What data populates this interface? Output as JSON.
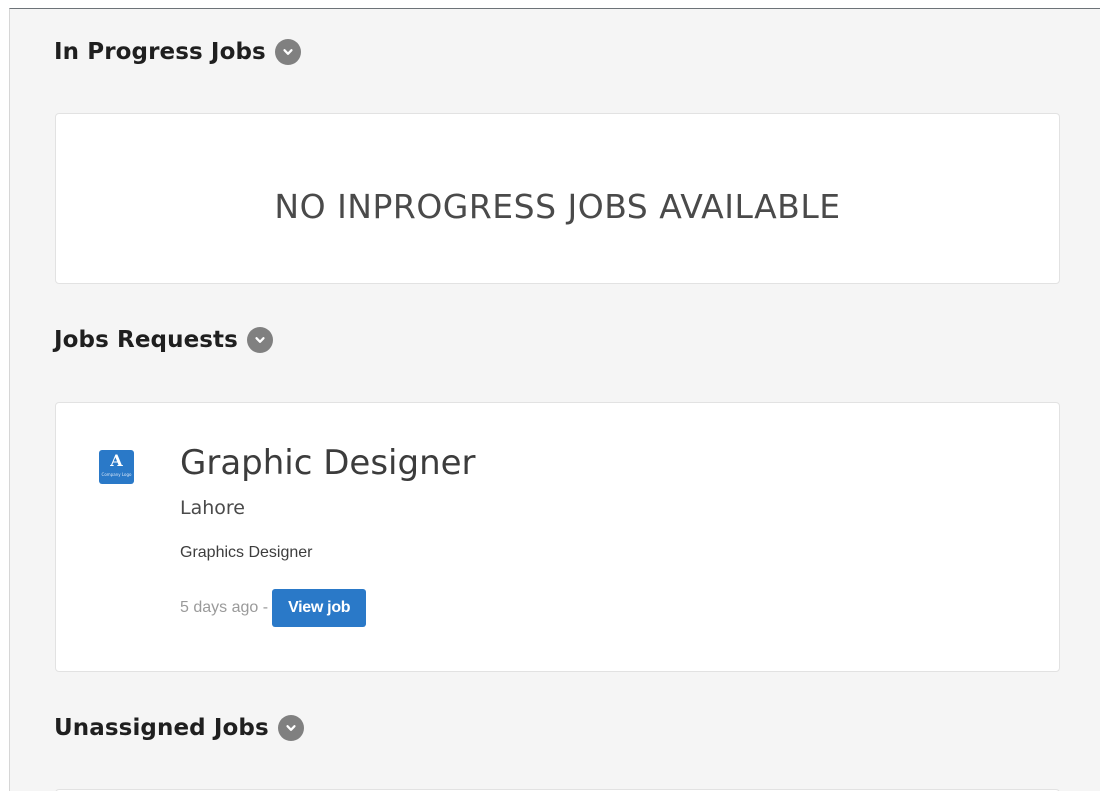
{
  "in_progress": {
    "heading": "In Progress Jobs",
    "toggle_icon": "chevron-down-icon",
    "empty_message": "NO INPROGRESS JOBS AVAILABLE"
  },
  "job_requests": {
    "heading": "Jobs Requests",
    "toggle_icon": "chevron-down-icon",
    "jobs": [
      {
        "logo_letter": "A",
        "logo_subtext": "Company Logo",
        "title": "Graphic Designer",
        "location": "Lahore",
        "category": "Graphics Designer",
        "posted": "5 days ago -",
        "action_label": "View job"
      }
    ]
  },
  "unassigned": {
    "heading": "Unassigned Jobs",
    "toggle_icon": "chevron-down-icon"
  },
  "colors": {
    "accent": "#2a79c8",
    "panel_bg": "#f5f5f5",
    "toggle_bg": "#808080"
  }
}
